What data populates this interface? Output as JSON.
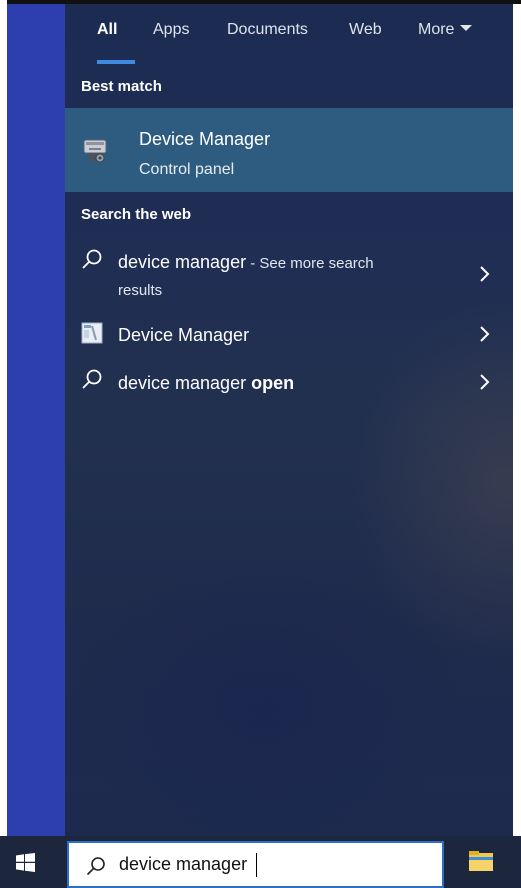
{
  "tabs": [
    {
      "label": "All",
      "active": true
    },
    {
      "label": "Apps",
      "active": false
    },
    {
      "label": "Documents",
      "active": false
    },
    {
      "label": "Web",
      "active": false
    },
    {
      "label": "More",
      "active": false,
      "icon": "caret-down-icon"
    }
  ],
  "best_match": {
    "header": "Best match",
    "title": "Device Manager",
    "subtitle": "Control panel",
    "icon": "device-manager-icon"
  },
  "search_web": {
    "header": "Search the web",
    "items": [
      {
        "main": "device manager",
        "suffix": " - See more search",
        "second_line": "results",
        "icon": "search-icon"
      },
      {
        "main": "Device Manager",
        "icon": "web-page-icon"
      },
      {
        "main": "device manager ",
        "bold": "open",
        "icon": "search-icon"
      }
    ]
  },
  "taskbar": {
    "search_value": "device manager",
    "start_icon": "windows-start-icon",
    "explorer_icon": "file-explorer-icon"
  },
  "colors": {
    "sidebar": "#2d3eaf",
    "panel": "#1f2d55",
    "selected": "#2e5c80",
    "accent": "#3f8be0",
    "taskbar": "#1c273d"
  }
}
